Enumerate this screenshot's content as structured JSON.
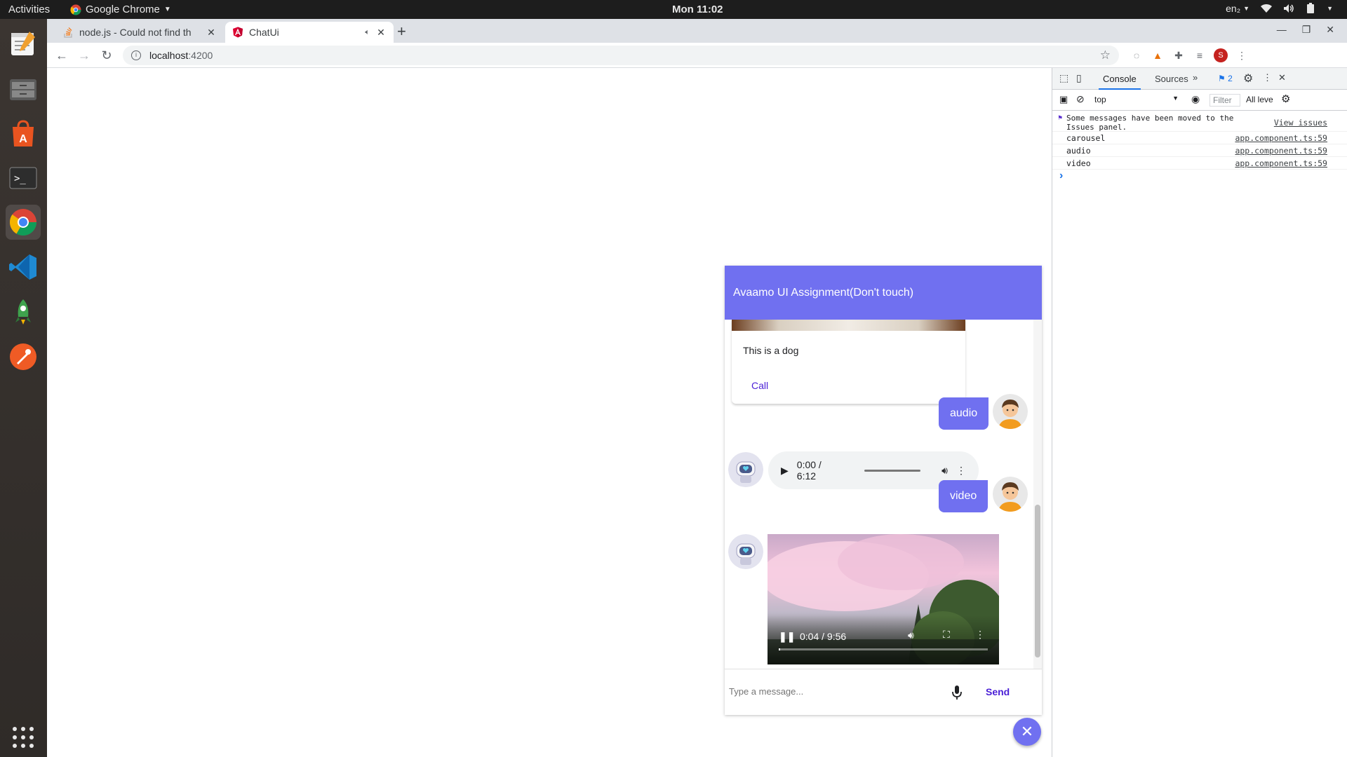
{
  "system": {
    "activities": "Activities",
    "app_menu": "Google Chrome",
    "clock": "Mon 11:02",
    "language": "en₂"
  },
  "browser": {
    "tabs": [
      {
        "title": "node.js - Could not find th",
        "active": false
      },
      {
        "title": "ChatUi",
        "active": true
      }
    ],
    "url_host": "localhost",
    "url_port": ":4200",
    "profile_initial": "S"
  },
  "chat": {
    "header_title": "Avaamo UI Assignment(Don't touch)",
    "card_text": "This is a dog",
    "card_button": "Call",
    "messages": [
      {
        "from": "user",
        "text": "audio"
      },
      {
        "from": "bot",
        "type": "audio",
        "time": "0:00 / 6:12"
      },
      {
        "from": "user",
        "text": "video"
      },
      {
        "from": "bot",
        "type": "video",
        "time": "0:04 / 9:56",
        "progress_fraction": 0.007
      }
    ],
    "input_placeholder": "Type a message...",
    "send_label": "Send"
  },
  "devtools": {
    "tabs": [
      "Console",
      "Sources"
    ],
    "issues_count": "2",
    "context": "top",
    "filter_placeholder": "Filter",
    "levels": "All leve",
    "notice_text": "Some messages have been moved to the Issues panel.",
    "notice_link": "View issues",
    "logs": [
      {
        "text": "carousel",
        "source": "app.component.ts:59"
      },
      {
        "text": "audio",
        "source": "app.component.ts:59"
      },
      {
        "text": "video",
        "source": "app.component.ts:59"
      }
    ],
    "prompt": "›"
  },
  "colors": {
    "brand": "#7070f0",
    "link": "#4a1fd6"
  }
}
